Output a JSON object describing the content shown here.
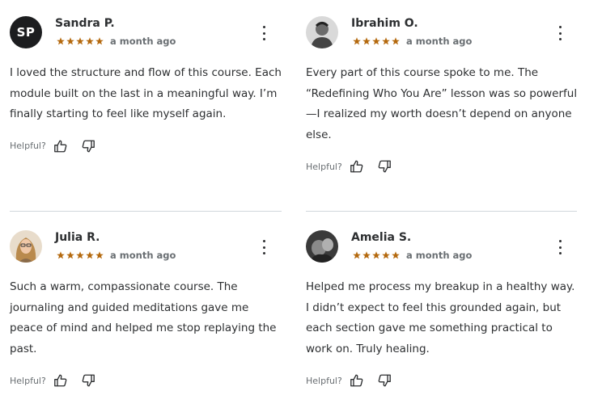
{
  "colors": {
    "star": "#b4690e",
    "text": "#2d2f31",
    "muted": "#6a6f73",
    "divider": "#d1d7dc",
    "avatar_initials_bg": "#1c1d1f"
  },
  "helpful_label": "Helpful?",
  "reviews": [
    {
      "name": "Sandra P.",
      "initials": "SP",
      "rating": 5,
      "time": "a month ago",
      "text": "I loved the structure and flow of this course. Each module built on the last in a meaningful way. I’m finally starting to feel like myself again."
    },
    {
      "name": "Ibrahim O.",
      "rating": 5,
      "time": "a month ago",
      "text": "Every part of this course spoke to me. The “Redefining Who You Are” lesson was so powerful—I realized my worth doesn’t depend on anyone else."
    },
    {
      "name": "Julia R.",
      "rating": 5,
      "time": "a month ago",
      "text": "Such a warm, compassionate course. The journaling and guided meditations gave me peace of mind and helped me stop replaying the past."
    },
    {
      "name": "Amelia S.",
      "rating": 5,
      "time": "a month ago",
      "text": "Helped me process my breakup in a healthy way. I didn’t expect to feel this grounded again, but each section gave me something practical to work on. Truly healing."
    }
  ]
}
